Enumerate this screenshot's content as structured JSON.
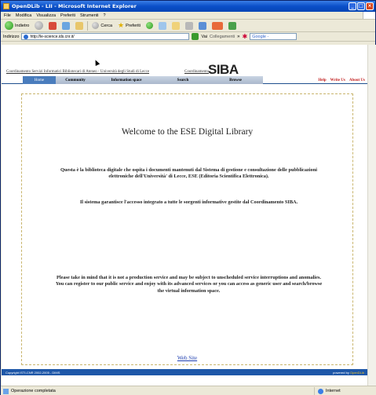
{
  "window": {
    "title": "OpenDLib - LII - Microsoft Internet Explorer"
  },
  "menubar": {
    "items": [
      "File",
      "Modifica",
      "Visualizza",
      "Preferiti",
      "Strumenti",
      "?"
    ]
  },
  "toolbar": {
    "back_label": "Indietro",
    "search_label": "Cerca",
    "favorites_label": "Preferiti"
  },
  "addressbar": {
    "label": "Indirizzo",
    "url": "http://le-science.ids.cnr.it/",
    "go_label": "Vai",
    "links_label": "Collegamenti",
    "google_label": "Google -"
  },
  "site": {
    "header_link": "Coordinamento Servizi Informatici Bibliotecari di Ateneo - Università degli Studi di Lecce",
    "header_siba_small": "Coordinamento",
    "logo": "SIBA",
    "nav": [
      "Home",
      "Community",
      "Information space",
      "Search",
      "Browse"
    ],
    "nav_right": [
      "Help",
      "Write Us",
      "About Us"
    ],
    "welcome": "Welcome to the ESE Digital Library",
    "para1": "Questa è la biblioteca digitale che ospita i documenti mantenuti dal Sistema di gestione e consultazione delle pubblicazioni elettroniche dell'Università' di Lecce, ESE (Editoria Scientifica Elettronica).",
    "para2": "Il sistema garantisce l'accesso integrato a tutte le sorgenti informative gestite dal Coordinamento SIBA.",
    "para3": "Please take in mind that it is not a production service and may be subject to unscheduled service interruptions and anomalies. You can register to our public service and enjoy with its advanced services or you can access as generic user and search/browse the virtual information space.",
    "website_link": "Web Site",
    "footer_copyright": "Copyright ISTI-CNR 2002-2005 - DIMS",
    "footer_powered": "powered by",
    "footer_brand": "OpenDLib"
  },
  "statusbar": {
    "text": "Operazione completata",
    "zone": "Internet"
  }
}
